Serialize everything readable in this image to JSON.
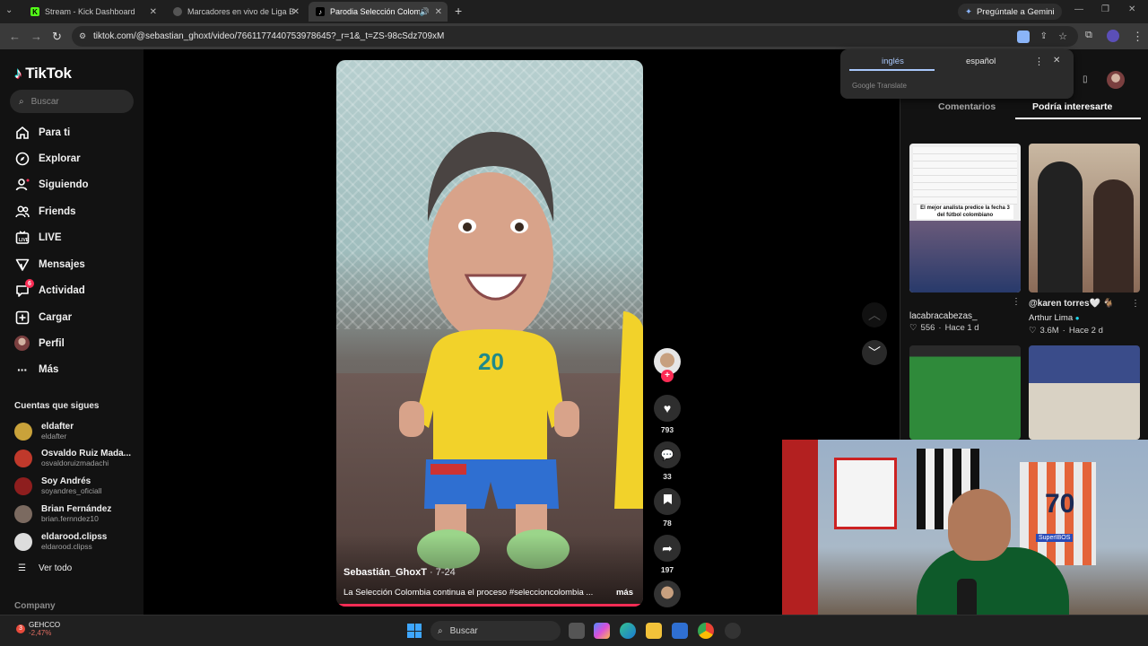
{
  "browser": {
    "tabs": [
      {
        "label": "Stream - Kick Dashboard",
        "favicon": "K",
        "favicon_color": "#53fc18",
        "active": false
      },
      {
        "label": "Marcadores en vivo de Liga Betp",
        "favicon": "",
        "favicon_color": "#555555",
        "active": false
      },
      {
        "label": "Parodia Selección Colombia",
        "favicon": "♪",
        "favicon_color": "#000000",
        "active": true
      }
    ],
    "gemini_label": "Pregúntale a Gemini",
    "url": "tiktok.com/@sebastian_ghoxt/video/7661177440753978645?_r=1&_t=ZS-98cSdz709xM"
  },
  "translate": {
    "lang_active": "inglés",
    "lang_other": "español",
    "brand": "Google Translate"
  },
  "sidebar": {
    "logo": "TikTok",
    "search_placeholder": "Buscar",
    "nav": [
      {
        "label": "Para ti",
        "icon": "home-icon"
      },
      {
        "label": "Explorar",
        "icon": "compass-icon"
      },
      {
        "label": "Siguiendo",
        "icon": "following-icon"
      },
      {
        "label": "Friends",
        "icon": "friends-icon"
      },
      {
        "label": "LIVE",
        "icon": "live-icon"
      },
      {
        "label": "Mensajes",
        "icon": "messages-icon"
      },
      {
        "label": "Actividad",
        "icon": "activity-icon",
        "badge": "6"
      },
      {
        "label": "Cargar",
        "icon": "upload-icon"
      },
      {
        "label": "Perfil",
        "icon": "profile-icon"
      },
      {
        "label": "Más",
        "icon": "more-icon"
      }
    ],
    "following_title": "Cuentas que sigues",
    "accounts": [
      {
        "name": "eldafter",
        "handle": "eldafter",
        "color": "#c9a23a"
      },
      {
        "name": "Osvaldo Ruiz Mada...",
        "handle": "osvaldoruizmadachi",
        "color": "#c0392b"
      },
      {
        "name": "Soy Andrés",
        "handle": "soyandres_oficiall",
        "color": "#8e1e1e"
      },
      {
        "name": "Brian Fernández",
        "handle": "brian.fernndez10",
        "color": "#7b6a60"
      },
      {
        "name": "eldarood.clipss",
        "handle": "eldarood.clipss",
        "color": "#dddddd"
      }
    ],
    "see_all": "Ver todo",
    "company": "Company"
  },
  "video": {
    "author": "Sebastián_GhoxT",
    "date": "7-24",
    "caption": "La Selección Colombia continua el proceso #seleccioncolombia ...",
    "more": "más",
    "jersey_number": "20"
  },
  "actions": {
    "likes": "793",
    "comments": "33",
    "saves": "78",
    "shares": "197"
  },
  "right_panel": {
    "tab_comments": "Comentarios",
    "tab_suggested": "Podría interesarte",
    "items": [
      {
        "title": "lacabracabezas_",
        "likes": "556",
        "time": "Hace 1 d",
        "overlay": "El mejor analista predice la fecha 3 del fútbol colombiano"
      },
      {
        "title": "@karen torres🤍 🐐",
        "author": "Arthur Lima",
        "likes": "3.6M",
        "time": "Hace 2 d"
      }
    ]
  },
  "taskbar": {
    "ticker": "GEHCCO",
    "ticker_change": "-2,47%",
    "search": "Buscar"
  },
  "webcam": {
    "shirt_number": "70",
    "sponsor": "SuperIBOS"
  }
}
